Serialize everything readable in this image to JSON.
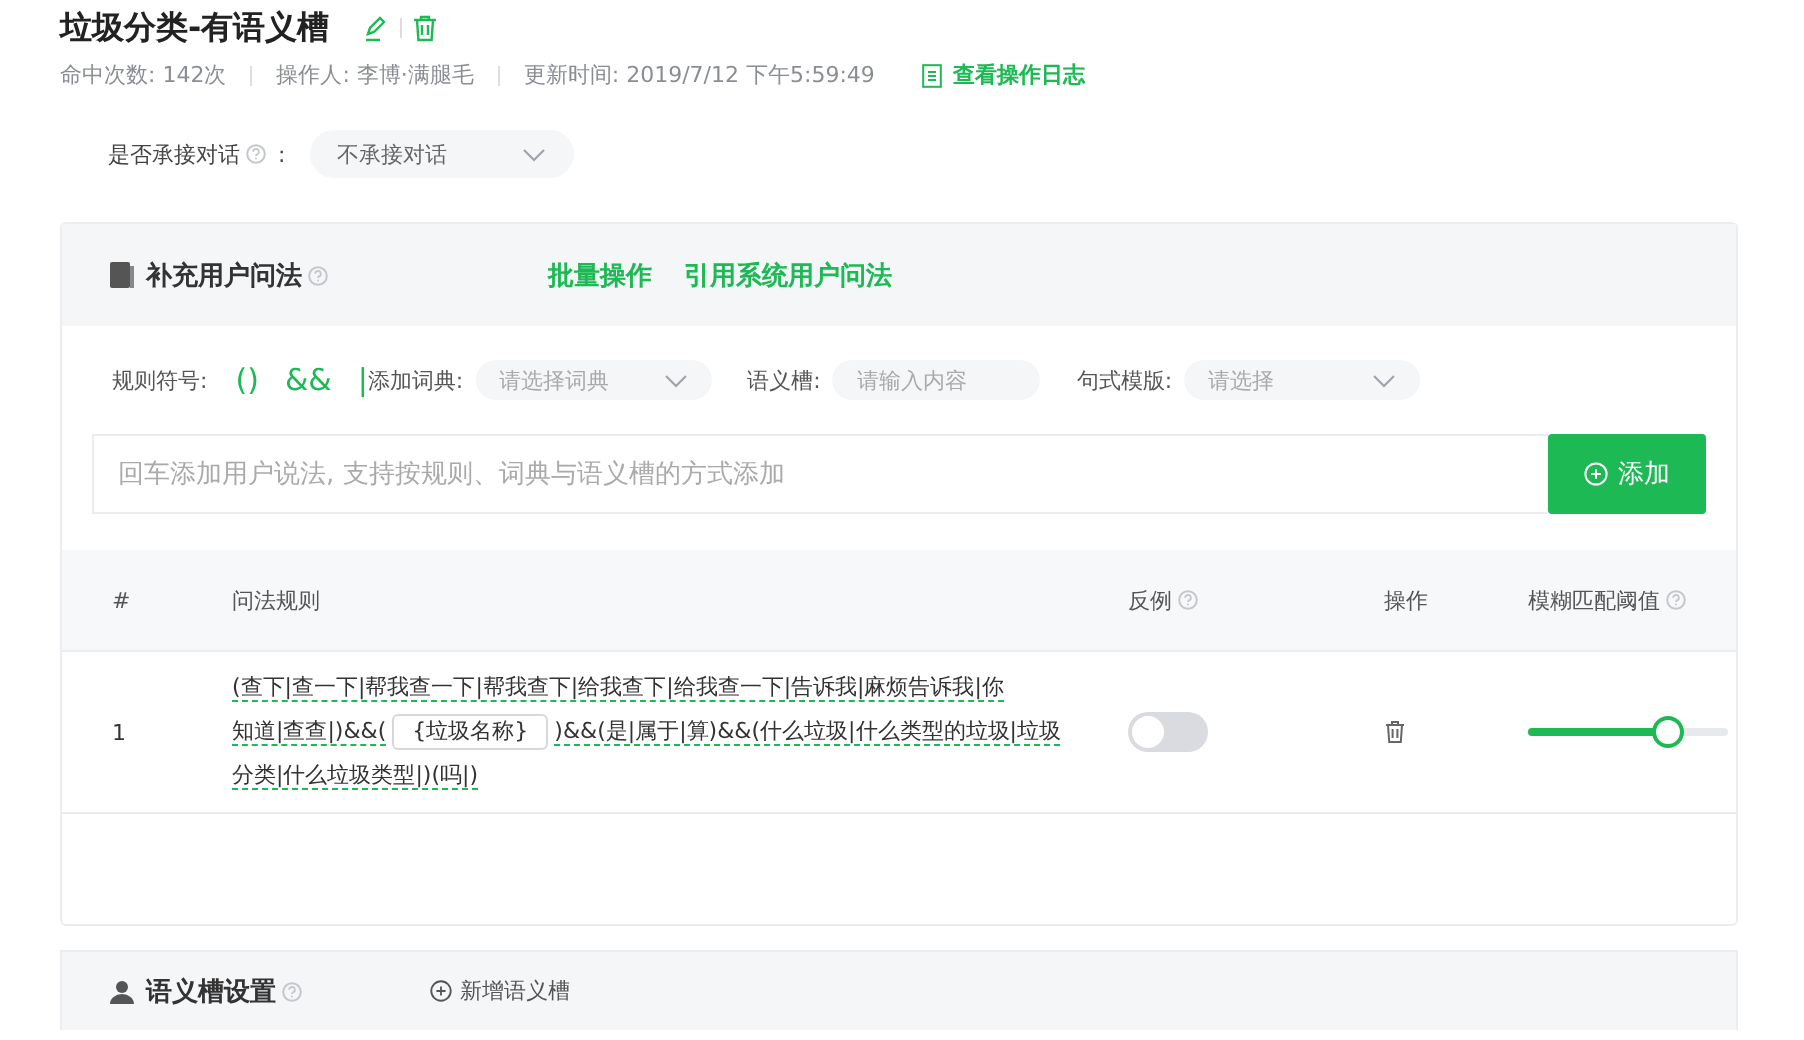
{
  "header": {
    "title": "垃圾分类-有语义槽",
    "meta": [
      {
        "label": "命中次数:",
        "value": "142次"
      },
      {
        "label": "操作人:",
        "value": "李博·满腿毛"
      },
      {
        "label": "更新时间:",
        "value": "2019/7/12 下午5:59:49"
      }
    ],
    "log_link": "查看操作日志"
  },
  "dialog_setting": {
    "label": "是否承接对话",
    "colon": ":",
    "value": "不承接对话"
  },
  "user_phrases": {
    "title": "补充用户问法",
    "actions": [
      "批量操作",
      "引用系统用户问法"
    ],
    "rule_symbols": {
      "label": "规则符号:",
      "symbols": [
        "()",
        "&&",
        "|"
      ]
    },
    "filters": [
      {
        "kind": "select",
        "label": "添加词典:",
        "placeholder": "请选择词典"
      },
      {
        "kind": "input",
        "label": "语义槽:",
        "placeholder": "请输入内容"
      },
      {
        "kind": "select",
        "label": "句式模版:",
        "placeholder": "请选择"
      }
    ],
    "input": {
      "placeholder": "回车添加用户说法, 支持按规则、词典与语义槽的方式添加"
    },
    "add_button": "添加",
    "table": {
      "columns": [
        {
          "label": "#",
          "help": false
        },
        {
          "label": "问法规则",
          "help": false
        },
        {
          "label": "反例",
          "help": true
        },
        {
          "label": "操作",
          "help": false
        },
        {
          "label": "模糊匹配阈值",
          "help": true
        }
      ],
      "rows": [
        {
          "index": "1",
          "rule_lines": [
            [
              {
                "kind": "text",
                "text": "(查下|查一下|帮我查一下|帮我查下|给我查下|给我查一下|告诉我|麻烦告诉我|你"
              }
            ],
            [
              {
                "kind": "text",
                "text": "知道|查查|)&&("
              },
              {
                "kind": "slot",
                "text": "{垃圾名称}"
              },
              {
                "kind": "text",
                "text": ")&&(是|属于|算)&&(什么垃圾|什么类型的垃圾|垃圾"
              }
            ],
            [
              {
                "kind": "text",
                "text": "分类|什么垃圾类型|)(吗|)"
              }
            ]
          ],
          "counter_example": false,
          "level": 0.7
        }
      ]
    }
  },
  "slot_settings": {
    "title": "语义槽设置",
    "add_link": "新增语义槽"
  }
}
